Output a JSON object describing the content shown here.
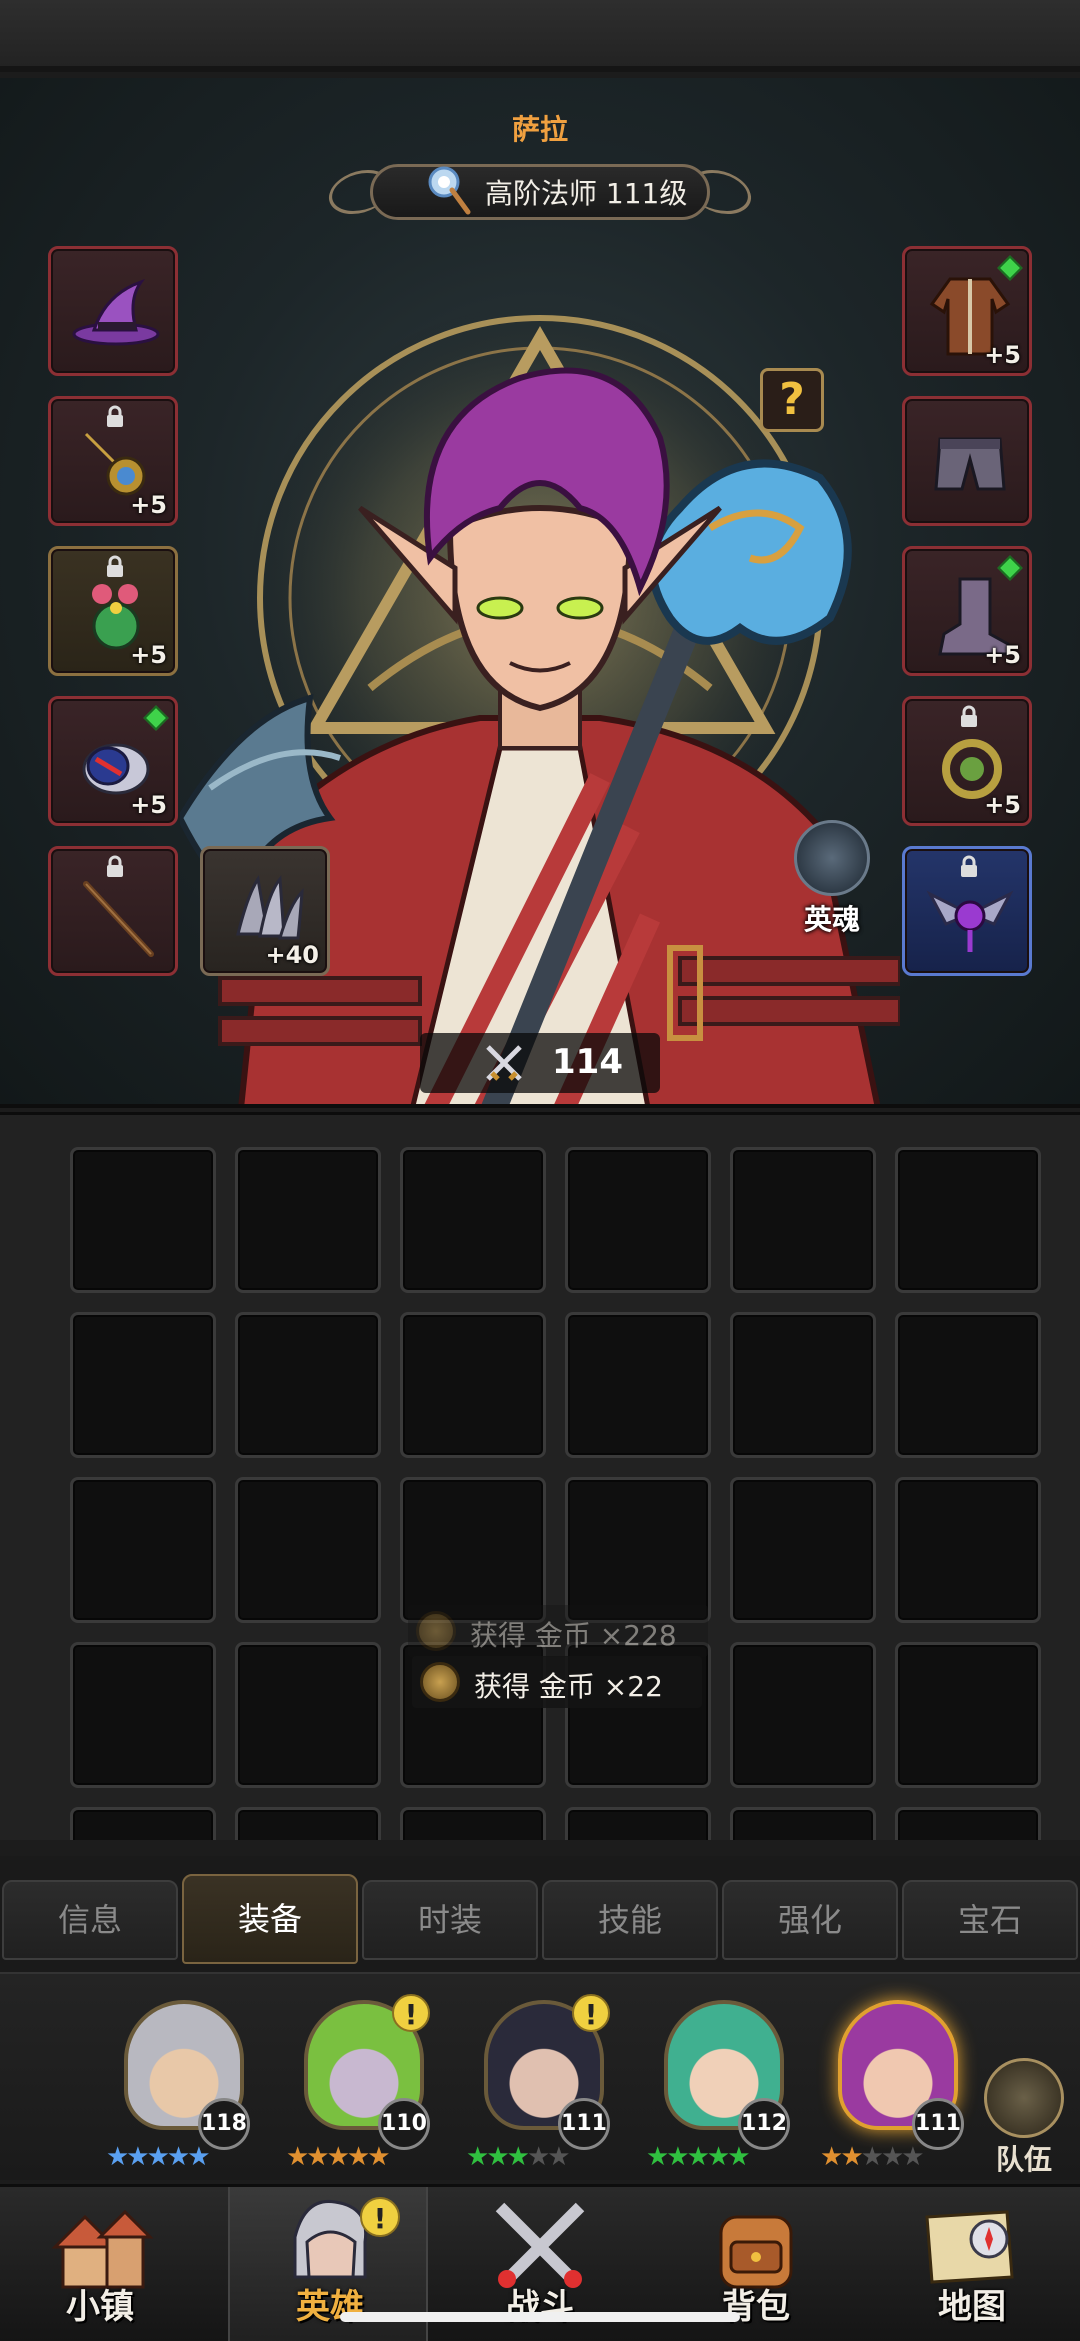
{
  "hero": {
    "name": "萨拉",
    "class_label": "高阶法师 111级",
    "power_value": "114",
    "soul_label": "英魂",
    "help_mark": "?"
  },
  "equipment": {
    "left": [
      {
        "icon": "wizard-hat-icon",
        "plus": "",
        "locked": false,
        "gem": false
      },
      {
        "icon": "amulet-icon",
        "plus": "+5",
        "locked": true,
        "gem": false
      },
      {
        "icon": "charm-icon",
        "plus": "+5",
        "locked": true,
        "gem": false
      },
      {
        "icon": "ring-bracer-icon",
        "plus": "+5",
        "locked": false,
        "gem": true
      },
      {
        "icon": "wand-icon",
        "plus": "",
        "locked": true,
        "gem": false
      }
    ],
    "claw": {
      "icon": "claw-icon",
      "plus": "+40"
    },
    "right": [
      {
        "icon": "robe-icon",
        "plus": "+5",
        "locked": false,
        "gem": true
      },
      {
        "icon": "pants-icon",
        "plus": "",
        "locked": false,
        "gem": false
      },
      {
        "icon": "boots-icon",
        "plus": "+5",
        "locked": false,
        "gem": true
      },
      {
        "icon": "earring-icon",
        "plus": "+5",
        "locked": true,
        "gem": false
      },
      {
        "icon": "winged-gem-icon",
        "plus": "",
        "locked": true,
        "gem": false
      }
    ]
  },
  "toasts": {
    "faded": "获得 金币 ×228",
    "current": "获得 金币 ×22"
  },
  "tabs": [
    "信息",
    "装备",
    "时装",
    "技能",
    "强化",
    "宝石"
  ],
  "active_tab": 1,
  "roster": {
    "heroes": [
      {
        "level": "118",
        "stars": "★★★★★",
        "star_color": "#5aa0f0",
        "alert": false,
        "hair": "#b8b8c0",
        "skin": "#e8c8a8"
      },
      {
        "level": "110",
        "stars": "★★★★★",
        "star_color": "#e09030",
        "alert": true,
        "alert_mark": "!",
        "hair": "#7ac040",
        "skin": "#c8b8d0"
      },
      {
        "level": "111",
        "stars": "★★★★★",
        "star_color": "#30c040",
        "dim_count": 2,
        "alert": true,
        "alert_mark": "!",
        "hair": "#2a2a3a",
        "skin": "#e0c0b0"
      },
      {
        "level": "112",
        "stars": "★★★★★",
        "star_color": "#30c040",
        "alert": false,
        "hair": "#40b090",
        "skin": "#f0d0b8"
      },
      {
        "level": "111",
        "stars": "★★★★★",
        "star_color": "#e09030",
        "dim_count": 3,
        "alert": false,
        "hair": "#9a3aa0",
        "skin": "#f0c8b0",
        "selected": true
      }
    ],
    "team_label": "队伍"
  },
  "nav": {
    "items": [
      "小镇",
      "英雄",
      "战斗",
      "背包",
      "地图"
    ],
    "active": 1,
    "alert_mark": "!"
  },
  "colors": {
    "accent_gold": "#f0a040",
    "slot_red": "#8c2f34",
    "slot_blue": "#5a7ad0"
  }
}
